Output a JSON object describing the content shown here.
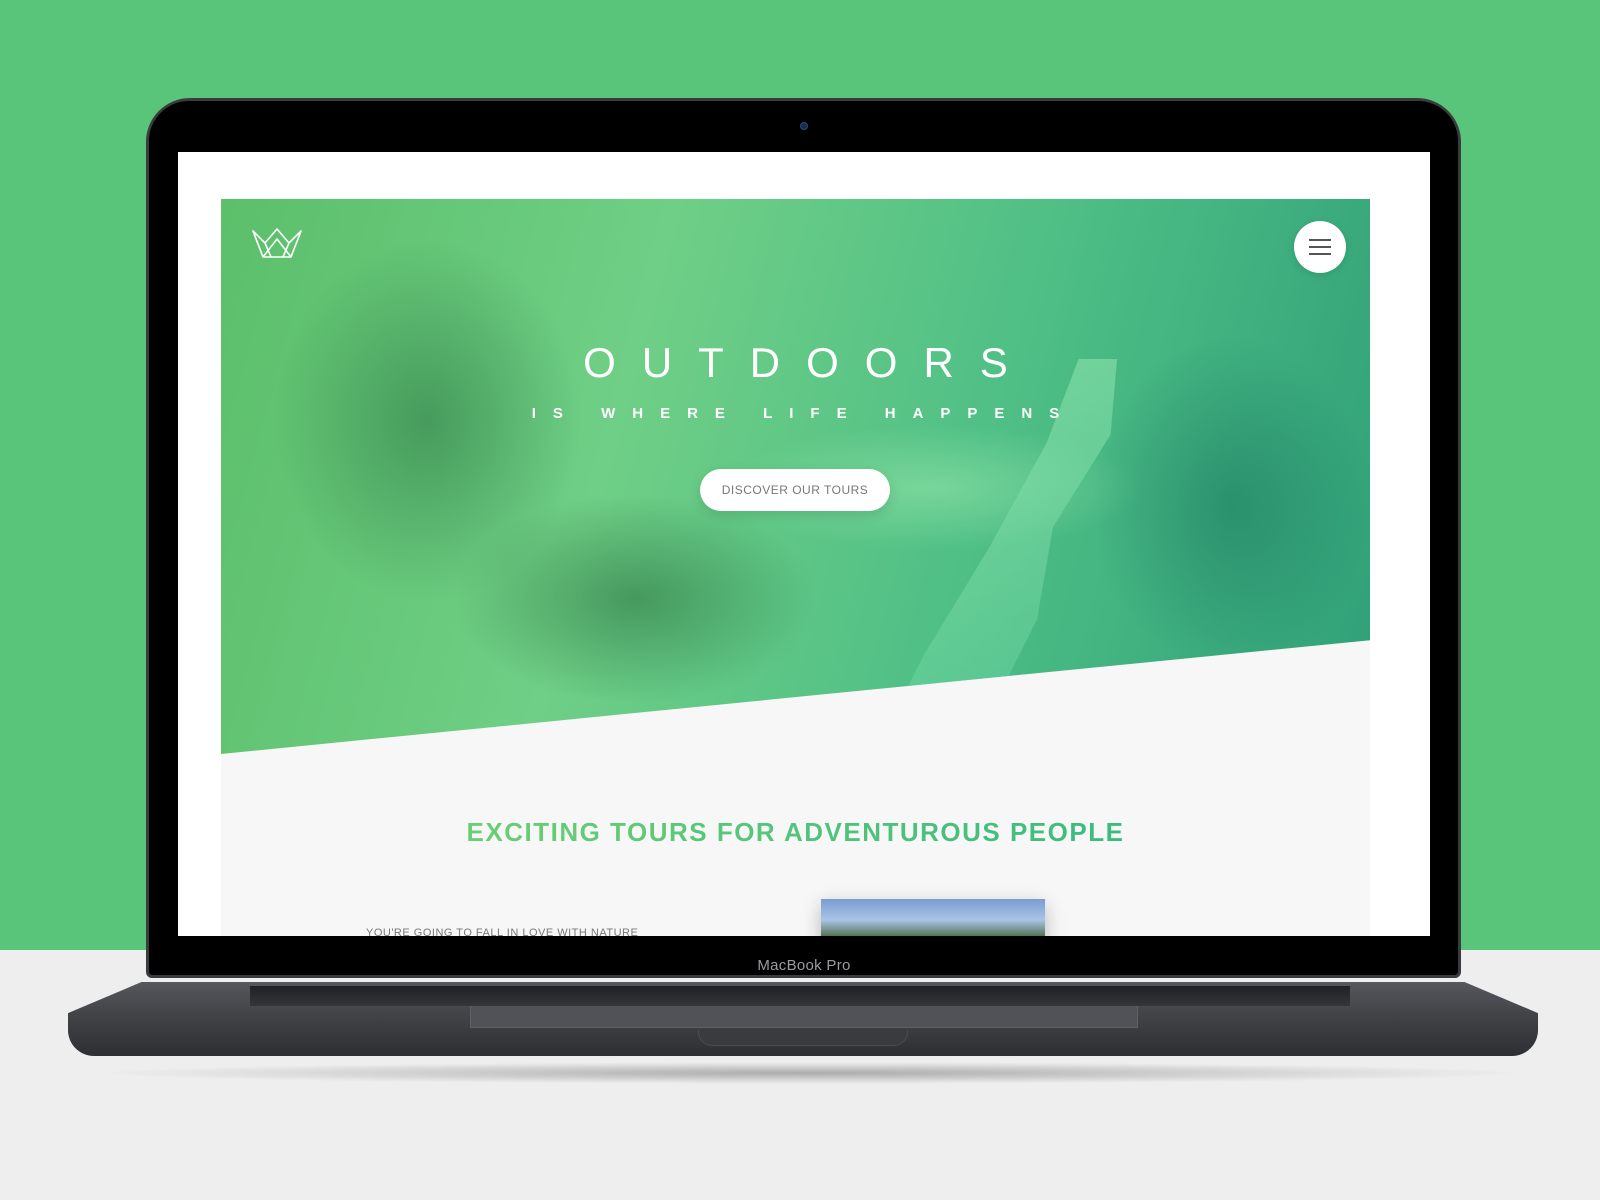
{
  "device": {
    "label": "MacBook Pro"
  },
  "site": {
    "hero": {
      "title": "OUTDOORS",
      "subtitle": "IS WHERE LIFE HAPPENS",
      "cta_label": "DISCOVER OUR TOURS"
    },
    "section": {
      "heading": "EXCITING TOURS FOR ADVENTUROUS PEOPLE",
      "subheading": "YOU'RE GOING TO FALL IN LOVE WITH NATURE"
    },
    "icons": {
      "logo": "crown-logo-icon",
      "menu": "hamburger-menu-icon"
    },
    "colors": {
      "brand_light": "#7ed56f",
      "brand_dark": "#28b485",
      "background": "#58c57a"
    }
  }
}
